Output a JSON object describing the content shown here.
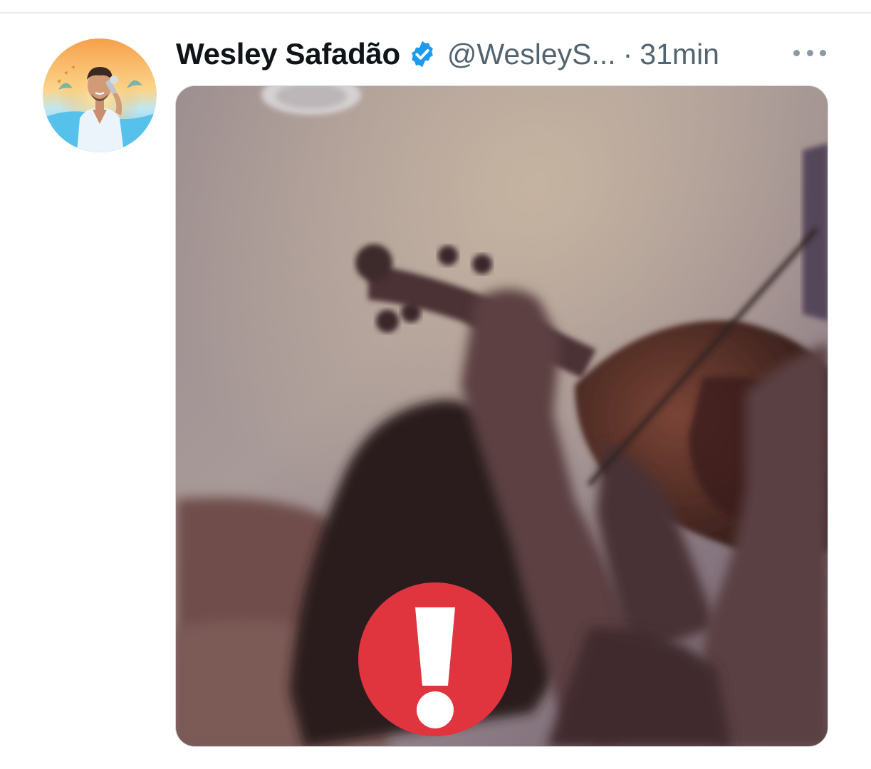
{
  "tweet": {
    "display_name": "Wesley Safadão",
    "handle": "@WesleyS...",
    "separator": "·",
    "time": "31min",
    "verified": true,
    "avatar_alt": "profile photo of a man singing into a microphone",
    "media_alt": "blurry video frame of a violin being played",
    "media_overlay_icon": "exclamation-alert-icon"
  },
  "colors": {
    "name": "#0f1419",
    "meta": "#536471",
    "verified_blue": "#1d9bf0",
    "alert_red": "#e0343e",
    "more_icon": "#8b98a5"
  }
}
